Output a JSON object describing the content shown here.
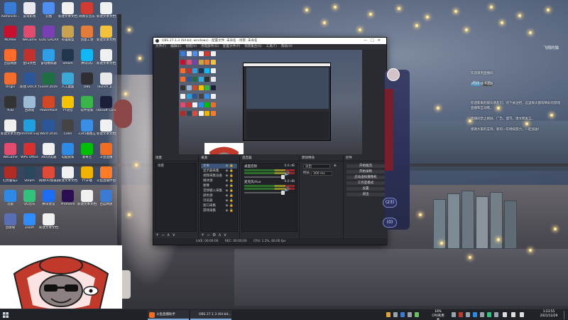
{
  "desktop": {
    "icons": [
      {
        "label": "Administr...",
        "color": "#3a7bd5"
      },
      {
        "label": "皮哥影视",
        "color": "#e8e8ee"
      },
      {
        "label": "云图",
        "color": "#4d8ef0"
      },
      {
        "label": "新建文本文档",
        "color": "#f0f0f0"
      },
      {
        "label": "网易云音乐",
        "color": "#d33a31"
      },
      {
        "label": "新建文本文档",
        "color": "#f0f0f0"
      },
      {
        "label": "McAfee",
        "color": "#c8102e"
      },
      {
        "label": "WeGame",
        "color": "#e24a6e"
      },
      {
        "label": "GOG GALAXY",
        "color": "#7a3fb3"
      },
      {
        "label": "英雄联盟",
        "color": "#c8a24c"
      },
      {
        "label": "创意工坊",
        "color": "#e37b3b"
      },
      {
        "label": "新建文本文档",
        "color": "#f3c13a"
      },
      {
        "label": "百度网盘",
        "color": "#ff6b2b"
      },
      {
        "label": "金山文档",
        "color": "#c4302b"
      },
      {
        "label": "雷电模拟器",
        "color": "#2f9fe8"
      },
      {
        "label": "Steam",
        "color": "#21354f"
      },
      {
        "label": "腾讯QQ",
        "color": "#12b7f5"
      },
      {
        "label": "新建文本文档",
        "color": "#f0f0f0"
      },
      {
        "label": "Origin",
        "color": "#f56c2d"
      },
      {
        "label": "新建 DOCX 文档",
        "color": "#2b579a"
      },
      {
        "label": "Excel 2016",
        "color": "#1d6f42"
      },
      {
        "label": "人工桌面",
        "color": "#3aa7d9"
      },
      {
        "label": "OBS",
        "color": "#2f2f33"
      },
      {
        "label": "launch_p...",
        "color": "#e8e8e8"
      },
      {
        "label": "YOD",
        "color": "#333"
      },
      {
        "label": "回收站",
        "color": "#9bbad6"
      },
      {
        "label": "PowerPoint",
        "color": "#d24726"
      },
      {
        "label": "YY语音",
        "color": "#f5c200"
      },
      {
        "label": "软件管家",
        "color": "#39b54a"
      },
      {
        "label": "Ubisoft Connect",
        "color": "#1b1f3a"
      },
      {
        "label": "新建文本文档",
        "color": "#f0f0f0"
      },
      {
        "label": "Internet Explorer",
        "color": "#1ea0e1"
      },
      {
        "label": "Word 2016",
        "color": "#2b579a"
      },
      {
        "label": "Coon",
        "color": "#444"
      },
      {
        "label": "2345看图王",
        "color": "#3b8ee5"
      },
      {
        "label": "新建文本文档",
        "color": "#f0f0f0"
      },
      {
        "label": "WeGame",
        "color": "#e24a6e"
      },
      {
        "label": "WPS Office",
        "color": "#d8302f"
      },
      {
        "label": "360浏览器",
        "color": "#f0f0f0"
      },
      {
        "label": "电脑管家",
        "color": "#2c8be6"
      },
      {
        "label": "爱奇艺",
        "color": "#00be06"
      },
      {
        "label": "斗鱼直播",
        "color": "#f26d21"
      },
      {
        "label": "红色警戒2",
        "color": "#b02c24"
      },
      {
        "label": "Steam",
        "color": "#2a475e"
      },
      {
        "label": "网易UU加速器",
        "color": "#e04a36"
      },
      {
        "label": "新建文本文档",
        "color": "#f0f0f0"
      },
      {
        "label": "YY开播",
        "color": "#f0b400"
      },
      {
        "label": "斗鱼直播伴侣",
        "color": "#ff7b28"
      },
      {
        "label": "迅雷",
        "color": "#2e8ae6"
      },
      {
        "label": "QQ音乐",
        "color": "#31c27c"
      },
      {
        "label": "腾讯会议",
        "color": "#1b6ef3"
      },
      {
        "label": "Premiere",
        "color": "#2a0d52"
      },
      {
        "label": "新建文本文档",
        "color": "#f0f0f0"
      },
      {
        "label": "百度网盘",
        "color": "#3a7bd5"
      },
      {
        "label": "回收站",
        "color": "#5a6fb3"
      },
      {
        "label": "Zoom",
        "color": "#2d8cff"
      },
      {
        "label": "新建文本文档",
        "color": "#f0f0f0"
      }
    ]
  },
  "obs": {
    "title": "OBS 27.1.3 (64-bit, windows) - 配置文件: 未命名 - 场景: 未命名",
    "menu": [
      "文件(F)",
      "编辑(E)",
      "视图(V)",
      "停靠部件(D)",
      "配置文件(P)",
      "场景集合(S)",
      "工具(T)",
      "帮助(H)"
    ],
    "docks": {
      "scenes": {
        "title": "场景",
        "items": [
          "场景"
        ]
      },
      "sources": {
        "title": "来源",
        "items": [
          "文本",
          "显示器采集",
          "视频采集设备",
          "媒体源",
          "图像",
          "音频输入采集",
          "颜色源",
          "浏览器",
          "窗口采集",
          "游戏采集"
        ]
      },
      "mixer": {
        "title": "混音器",
        "channels": [
          {
            "name": "桌面音频",
            "db": "0.0 dB"
          },
          {
            "name": "麦克风/Aux",
            "db": "0.0 dB"
          }
        ]
      },
      "transitions": {
        "title": "转场特效",
        "type": "淡出",
        "duration_label": "时长",
        "duration": "300 ms"
      },
      "controls": {
        "title": "控件",
        "buttons": [
          "开始推流",
          "开始录制",
          "启动虚拟摄像机",
          "工作室模式",
          "设置",
          "退出"
        ]
      }
    },
    "status": {
      "live": "LIVE: 00:00:00",
      "rec": "REC: 00:00:00",
      "cpu": "CPU: 1.2%, 60.00 fps"
    }
  },
  "chat": {
    "username": "飞翔的猫",
    "messages": [
      "欢迎来到直播间",
      "关注主播不迷路",
      "欢迎新来的观众朋友们，点个关注吧，这里每天都有精彩的游戏直播和互动哦。",
      "直播间禁止刷屏、广告、谩骂，请文明发言。",
      "感谢大家的支持，新的一年继续努力，一起加油！"
    ],
    "badges": [
      "粉丝",
      "房管"
    ],
    "side_counts": [
      "23",
      "0"
    ]
  },
  "taskbar": {
    "items": [
      {
        "label": "斗鱼直播助手",
        "color": "#f26d21"
      },
      {
        "label": "OBS 27.1.3 (64-bit...",
        "color": "#2f2f33"
      }
    ],
    "cpu_percent": "16%",
    "cpu_label": "CPU利用率",
    "time": "1:23:55",
    "date": "2021/12/29"
  }
}
